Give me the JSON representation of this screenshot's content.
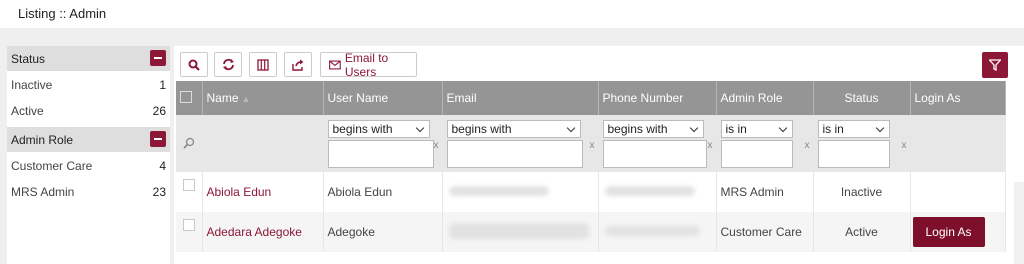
{
  "page": {
    "title": "Listing :: Admin"
  },
  "sidebar": {
    "groups": [
      {
        "label": "Status",
        "items": [
          {
            "label": "Inactive",
            "count": "1"
          },
          {
            "label": "Active",
            "count": "26"
          }
        ]
      },
      {
        "label": "Admin Role",
        "items": [
          {
            "label": "Customer Care",
            "count": "4"
          },
          {
            "label": "MRS Admin",
            "count": "23"
          }
        ]
      }
    ]
  },
  "toolbar": {
    "email_label": "Email to Users",
    "icons": [
      "search-icon",
      "refresh-icon",
      "columns-icon",
      "export-icon",
      "envelope-icon",
      "filter-icon"
    ]
  },
  "table": {
    "headers": {
      "name": "Name",
      "username": "User Name",
      "email": "Email",
      "phone": "Phone Number",
      "role": "Admin Role",
      "status": "Status",
      "login": "Login As"
    },
    "filters": {
      "username": "begins with",
      "email": "begins with",
      "phone": "begins with",
      "role": "is in",
      "status": "is in",
      "clear": "x"
    },
    "rows": [
      {
        "name": "Abiola Edun",
        "username": "Abiola Edun",
        "role": "MRS Admin",
        "status": "Inactive",
        "login": ""
      },
      {
        "name": "Adedara Adegoke",
        "username": "Adegoke",
        "role": "Customer Care",
        "status": "Active",
        "login": "Login As"
      }
    ]
  },
  "colors": {
    "accent": "#8c1736",
    "header_bg": "#959595"
  }
}
